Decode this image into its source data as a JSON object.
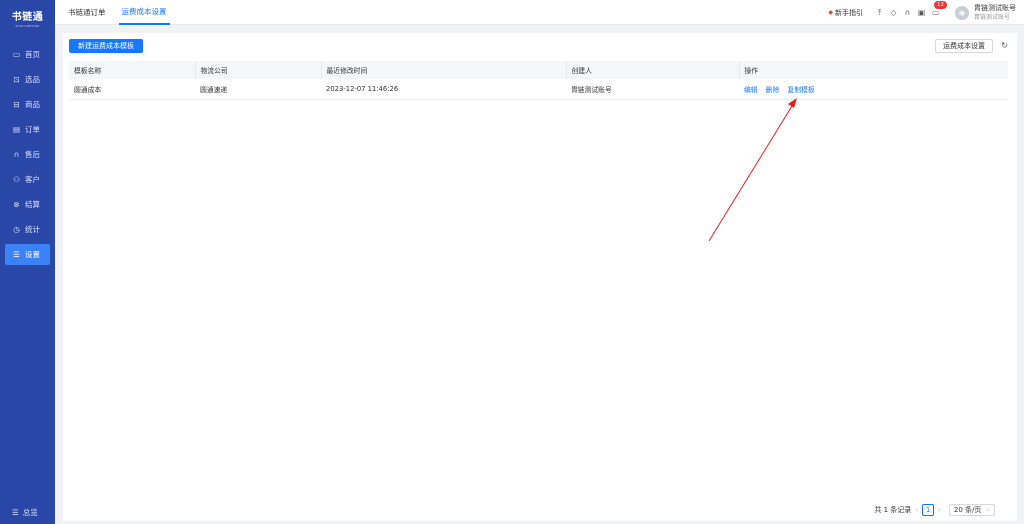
{
  "sidebar": {
    "logo": "书链通",
    "logo_sub": "SHULIANTONG",
    "items": [
      {
        "label": "首页",
        "icon": "monitor-icon"
      },
      {
        "label": "选品",
        "icon": "select-icon"
      },
      {
        "label": "商品",
        "icon": "box-icon"
      },
      {
        "label": "订单",
        "icon": "order-icon"
      },
      {
        "label": "售后",
        "icon": "headset-icon"
      },
      {
        "label": "客户",
        "icon": "users-icon"
      },
      {
        "label": "结算",
        "icon": "settle-icon"
      },
      {
        "label": "统计",
        "icon": "clock-icon"
      },
      {
        "label": "设置",
        "icon": "settings-icon"
      }
    ],
    "active_index": 8,
    "bottom": "总览"
  },
  "topbar": {
    "tabs": [
      "书链通订单",
      "运费成本设置"
    ],
    "active_tab": 1,
    "guide": "新手指引",
    "badge_count": "12",
    "user_name": "胄链测试账号",
    "user_sub": "胄链测试账号"
  },
  "toolbar": {
    "create_label": "新建运费成本模板",
    "settings_label": "运费成本设置"
  },
  "table": {
    "columns": [
      "模板名称",
      "物流公司",
      "最近修改时间",
      "创建人",
      "操作"
    ],
    "rows": [
      {
        "name": "圆通成本",
        "company": "圆通速递",
        "modified": "2023-12-07 11:46:26",
        "creator": "胄链测试账号",
        "ops": [
          "编辑",
          "删除",
          "复制模板"
        ]
      }
    ]
  },
  "pagination": {
    "total_text": "共 1 条记录",
    "current_page": "1",
    "page_size": "20 条/页"
  },
  "colors": {
    "sidebar_bg": "#2a46a6",
    "accent": "#1677ff",
    "annotation": "#e02020"
  }
}
